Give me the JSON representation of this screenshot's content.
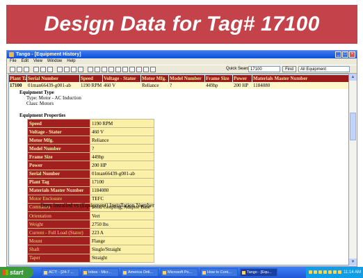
{
  "slide_title": "Design Data for Tag# 17100",
  "window": {
    "title": "Tango - [Equipment History]",
    "menu": [
      "File",
      "Edit",
      "View",
      "Window",
      "Help"
    ],
    "quick_search_label": "Quick Search:",
    "quick_search_value": "17100",
    "find_label": "Find",
    "scope_value": "All Equipment"
  },
  "table": {
    "headers": [
      "Plant Tag",
      "Serial Number",
      "Speed",
      "Voltage - Stator",
      "Motor Mfg.",
      "Model Number",
      "Frame Size",
      "Power",
      "Materials Master Number"
    ],
    "row": [
      "17100",
      "01man66439-g001-ab",
      "1190 RPM",
      "460 V",
      "Reliance",
      "?",
      "449hp",
      "200 HP",
      "1184080"
    ]
  },
  "equipment_type": {
    "heading": "Equipment Type",
    "type_line": "Type: Motor - AC Induction",
    "class_line": "Class: Motors"
  },
  "properties_heading": "Equipment Properties",
  "properties": [
    {
      "k": "Speed",
      "v": "1190 RPM"
    },
    {
      "k": "Voltage - Stator",
      "v": "460 V"
    },
    {
      "k": "Motor Mfg.",
      "v": "Reliance"
    },
    {
      "k": "Model Number",
      "v": "?"
    },
    {
      "k": "Frame Size",
      "v": "449hp"
    },
    {
      "k": "Power",
      "v": "200 HP"
    },
    {
      "k": "Serial Number",
      "v": "01man66439-g001-ab"
    },
    {
      "k": "Plant Tag",
      "v": "17100"
    },
    {
      "k": "Materials Master Number",
      "v": "1184080"
    },
    {
      "k": "Motor Enclosure",
      "v": "TEFC"
    },
    {
      "k": "Comments",
      "v": "Solid Coupling, Adaptor Base"
    },
    {
      "k": "Orientation",
      "v": "Vert"
    },
    {
      "k": "Weight",
      "v": "2750 lbs"
    },
    {
      "k": "Current - Full Load (Stator)",
      "v": "223 A"
    },
    {
      "k": "Mount",
      "v": "Flange"
    },
    {
      "k": "Shaft",
      "v": "Single/Straight"
    },
    {
      "k": "Taper",
      "v": "Straight"
    }
  ],
  "installations_title": "Days Installed vs (Equipment) Installation Number",
  "taskbar": {
    "start_label": "start",
    "tasks": [
      "ACT! - [24-7 ...",
      "Inbox - Micr...",
      "America Onli...",
      "Microsoft Po...",
      "How to Cont...",
      "Tango - [Equ..."
    ],
    "clock": "11:14 AM"
  },
  "colors": {
    "banner": "#c4434a",
    "header_row": "#9a1b1b",
    "property_key": "#a21f1f",
    "property_value": "#faf0a8"
  }
}
